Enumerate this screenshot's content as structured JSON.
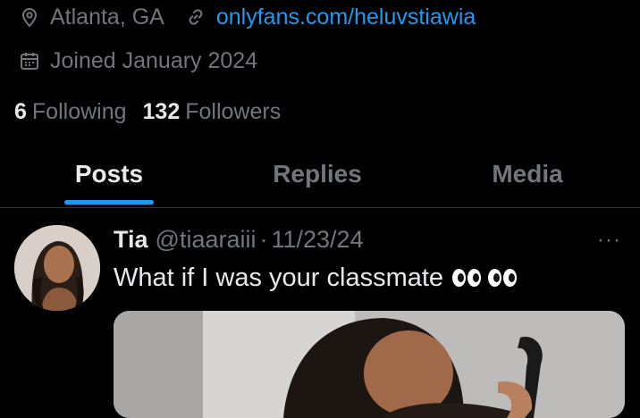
{
  "profile": {
    "location": "Atlanta, GA",
    "website": "onlyfans.com/heluvstiawia",
    "joined": "Joined January 2024",
    "following_count": "6",
    "following_label": "Following",
    "followers_count": "132",
    "followers_label": "Followers"
  },
  "tabs": [
    {
      "label": "Posts",
      "active": true
    },
    {
      "label": "Replies",
      "active": false
    },
    {
      "label": "Media",
      "active": false
    }
  ],
  "tweet": {
    "name": "Tia",
    "handle": "@tiaaraiii",
    "separator": "·",
    "date": "11/23/24",
    "text": "What if I was your classmate",
    "emoji": [
      "eyes",
      "eyes"
    ],
    "more": "···"
  },
  "colors": {
    "accent": "#1d9bf0",
    "muted": "#71767b",
    "background": "#000000"
  }
}
